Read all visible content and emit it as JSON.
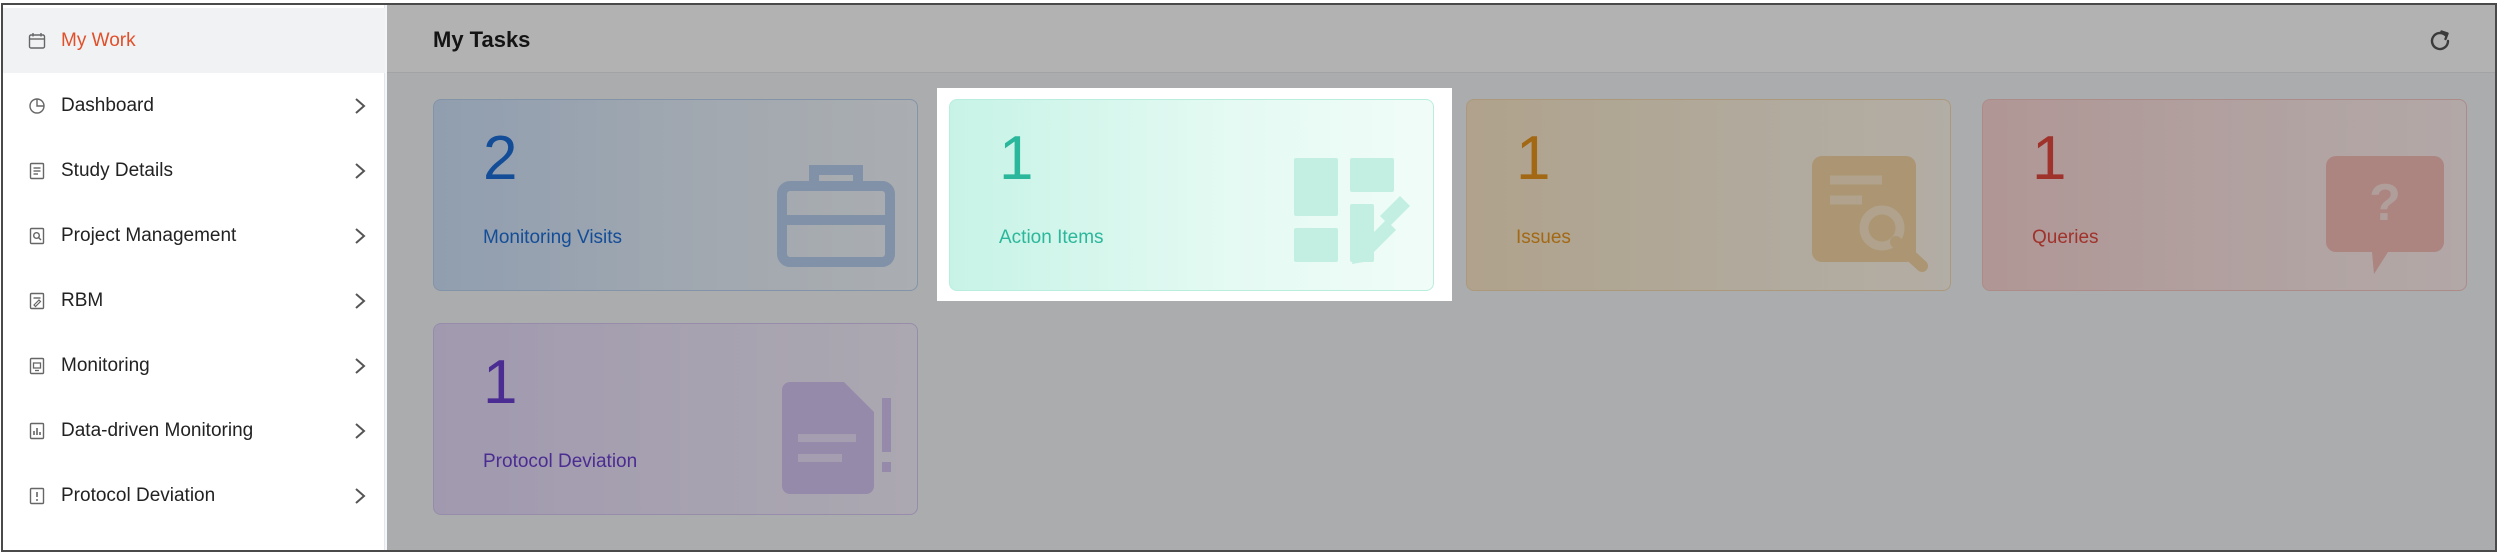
{
  "sidebar": {
    "items": [
      {
        "label": "My Work",
        "icon": "calendar-icon",
        "active": true
      },
      {
        "label": "Dashboard",
        "icon": "pie-chart-icon"
      },
      {
        "label": "Study Details",
        "icon": "document-list-icon"
      },
      {
        "label": "Project Management",
        "icon": "document-search-icon"
      },
      {
        "label": "RBM",
        "icon": "document-edit-icon"
      },
      {
        "label": "Monitoring",
        "icon": "document-monitor-icon"
      },
      {
        "label": "Data-driven Monitoring",
        "icon": "document-chart-icon"
      },
      {
        "label": "Protocol Deviation",
        "icon": "document-alert-icon"
      }
    ]
  },
  "main": {
    "title": "My Tasks",
    "refresh_icon": "refresh-icon",
    "cards": [
      {
        "count": "2",
        "label": "Monitoring Visits",
        "icon": "briefcase-icon",
        "color": "#1e6fd9"
      },
      {
        "count": "1",
        "label": "Action Items",
        "icon": "layout-edit-icon",
        "color": "#2bb79b",
        "highlighted": true
      },
      {
        "count": "1",
        "label": "Issues",
        "icon": "document-search-icon",
        "color": "#e8961e"
      },
      {
        "count": "1",
        "label": "Queries",
        "icon": "question-bubble-icon",
        "color": "#e5483f"
      },
      {
        "count": "1",
        "label": "Protocol Deviation",
        "icon": "document-alert-icon",
        "color": "#6c3fd1"
      }
    ]
  }
}
